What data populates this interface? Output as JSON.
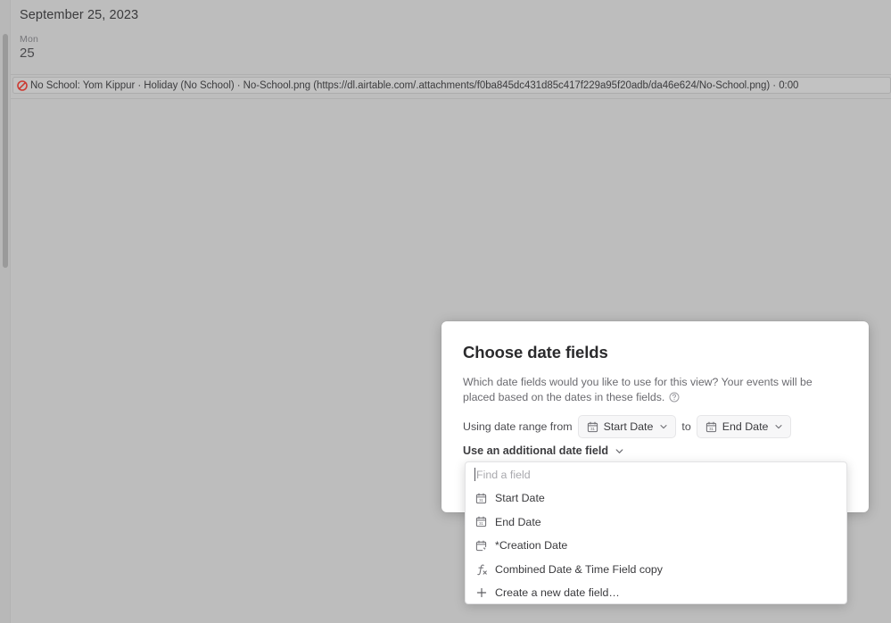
{
  "calendar": {
    "header_date": "September 25, 2023",
    "weekday": "Mon",
    "day_number": "25",
    "event": {
      "icon": "no-entry-icon",
      "text": "No School: Yom Kippur  · Holiday (No School) · No-School.png (https://dl.airtable.com/.attachments/f0ba845dc431d85c417f229a95f20adb/da46e624/No-School.png) · 0:00",
      "accent_color": "#cc3b33"
    }
  },
  "dialog": {
    "title": "Choose date fields",
    "description": "Which date fields would you like to use for this view? Your events will be placed based on the dates in these fields.",
    "help_icon": "question-circle-icon",
    "range_prefix": "Using date range from",
    "range_separator": "to",
    "start_field": {
      "label": "Start Date",
      "icon": "calendar-icon",
      "chevron": "chevron-down-icon"
    },
    "end_field": {
      "label": "End Date",
      "icon": "calendar-icon",
      "chevron": "chevron-down-icon"
    },
    "additional_field_toggle": {
      "label": "Use an additional date field",
      "chevron": "chevron-down-icon"
    }
  },
  "field_picker": {
    "search_placeholder": "Find a field",
    "options": [
      {
        "label": "Start Date",
        "icon": "calendar-icon"
      },
      {
        "label": "End Date",
        "icon": "calendar-icon"
      },
      {
        "label": "*Creation Date",
        "icon": "calendar-bolt-icon"
      },
      {
        "label": "Combined Date & Time Field copy",
        "icon": "formula-icon"
      },
      {
        "label": "Create a new date field…",
        "icon": "plus-icon"
      }
    ]
  },
  "colors": {
    "page_background": "#bdbdbd",
    "dialog_background": "#ffffff",
    "text_primary": "#3a3a3d",
    "text_secondary": "#6b6b70"
  }
}
